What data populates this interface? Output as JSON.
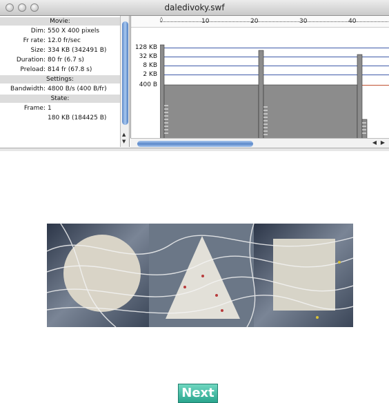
{
  "window": {
    "title": "daledivoky.swf"
  },
  "profiler": {
    "movie_header": "Movie:",
    "settings_header": "Settings:",
    "state_header": "State:",
    "rows": [
      {
        "label": "Dim:",
        "value": "550 X 400 pixels"
      },
      {
        "label": "Fr rate:",
        "value": "12.0 fr/sec"
      },
      {
        "label": "Size:",
        "value": "334 KB (342491 B)"
      },
      {
        "label": "Duration:",
        "value": "80 fr (6.7 s)"
      },
      {
        "label": "Preload:",
        "value": "814 fr (67.8 s)"
      }
    ],
    "bandwidth": {
      "label": "Bandwidth:",
      "value": "4800 B/s (400 B/fr)"
    },
    "frame": {
      "label": "Frame:",
      "value": "1"
    },
    "frame_size": "180 KB (184425 B)"
  },
  "graph": {
    "ruler_ticks": [
      "10",
      "20",
      "30",
      "40"
    ],
    "y_labels": [
      "128 KB",
      "32 KB",
      "8 KB",
      "2 KB",
      "400 B"
    ]
  },
  "stage": {
    "next_label": "Next"
  },
  "colors": {
    "accent": "#2aa58e",
    "grid": "#3d5aa8",
    "limit": "#c0502f",
    "bar": "#8c8c8c"
  }
}
